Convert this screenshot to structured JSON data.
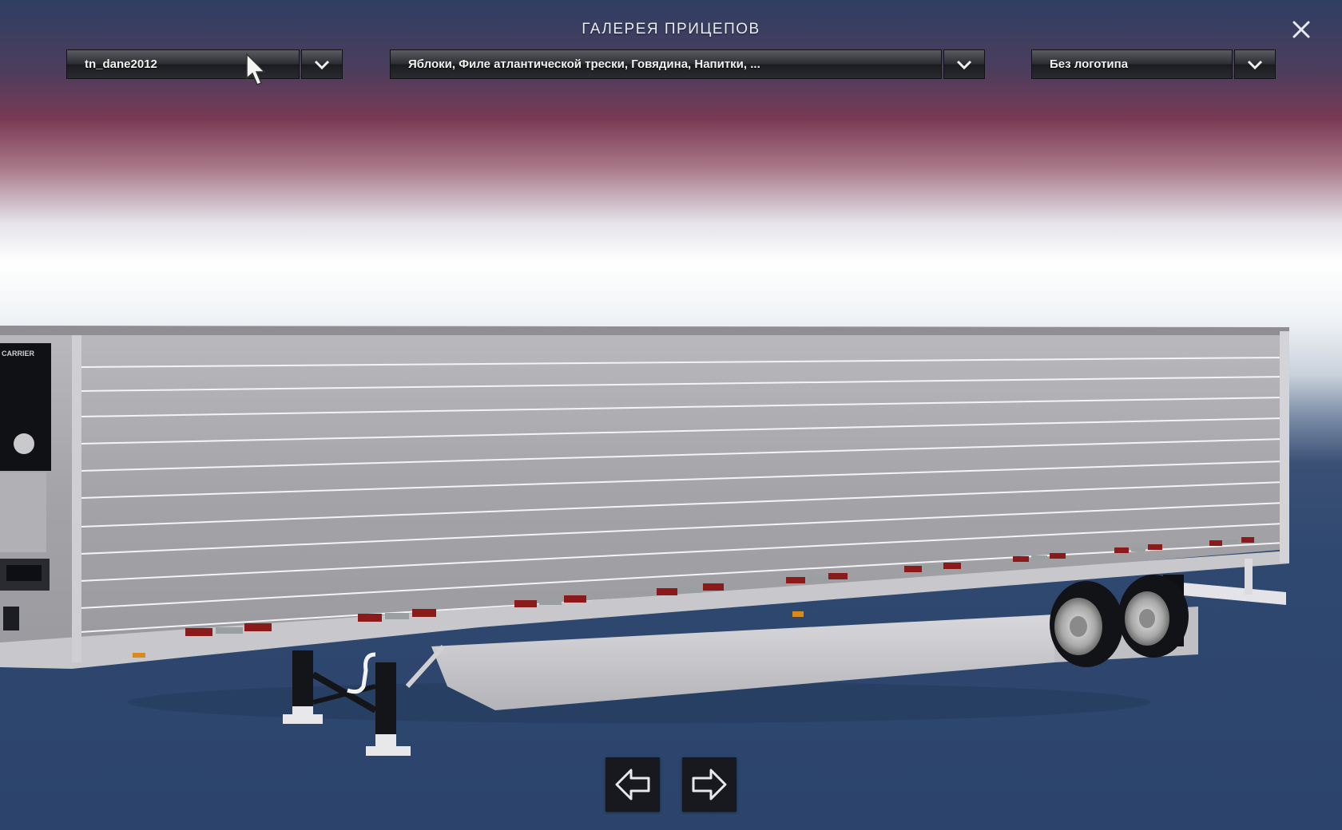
{
  "header": {
    "title": "ГАЛЕРЕЯ ПРИЦЕПОВ"
  },
  "filters": {
    "owner": {
      "value": "tn_dane2012"
    },
    "cargo": {
      "value": "Яблоки, Филе атлантической трески, Говядина, Напитки, ..."
    },
    "logo": {
      "value": "Без логотипа"
    }
  },
  "trailer": {
    "unit_brand": "CARRIER"
  },
  "icons": {
    "close": "close-icon",
    "dropdown": "chevron-down-icon",
    "prev": "arrow-left-icon",
    "next": "arrow-right-icon"
  }
}
